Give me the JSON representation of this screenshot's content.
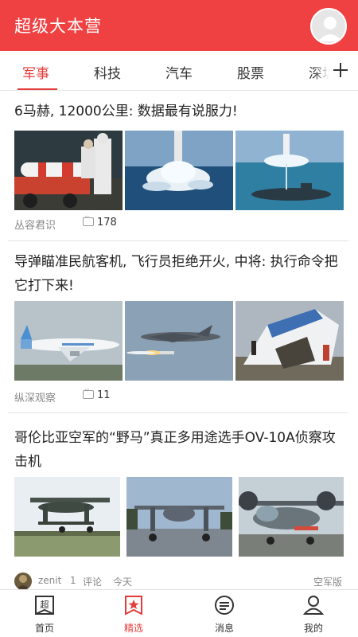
{
  "app": {
    "title": "超级大本营",
    "accent": "#f04142",
    "avatar_icon": "user-avatar-icon"
  },
  "tabs": [
    {
      "label": "军事",
      "active": true
    },
    {
      "label": "科技",
      "active": false
    },
    {
      "label": "汽车",
      "active": false
    },
    {
      "label": "股票",
      "active": false
    },
    {
      "label": "深圳",
      "active": false
    }
  ],
  "tab_add_icon": "plus-icon",
  "articles": [
    {
      "title": "6马赫, 12000公里: 数据最有说服力!",
      "source": "丛容君识",
      "comments": "178",
      "images": [
        "missile-truck-sailors",
        "submarine-launch-splash",
        "submarine-underwater-launch"
      ]
    },
    {
      "title": "导弹瞄准民航客机, 飞行员拒绝开火, 中将: 执行命令把它打下来!",
      "source": "纵深观察",
      "comments": "11",
      "images": [
        "korean-air-airliner",
        "fighter-jet-firing-missile",
        "airliner-crash-wreckage"
      ]
    },
    {
      "title": "哥伦比亚空军的“野马”真正多用途选手OV-10A侦察攻击机",
      "author": "zenit",
      "comment_count": "1",
      "comment_label": "评论",
      "time": "今天",
      "channel": "空军版",
      "images": [
        "ov10-bronco-runway",
        "ov10-bronco-tarmac-front",
        "ov10-bronco-display"
      ]
    }
  ],
  "bottom_nav": [
    {
      "label": "首页",
      "icon": "home-icon",
      "active": false
    },
    {
      "label": "精选",
      "icon": "star-badge-icon",
      "active": true
    },
    {
      "label": "消息",
      "icon": "message-icon",
      "active": false
    },
    {
      "label": "我的",
      "icon": "profile-icon",
      "active": false
    }
  ]
}
